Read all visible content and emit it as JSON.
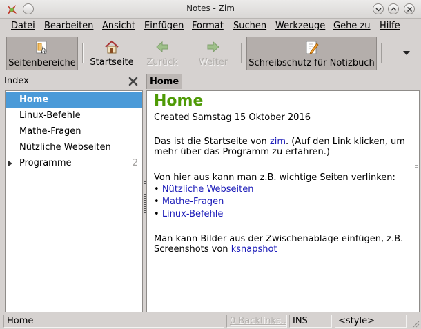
{
  "window": {
    "title": "Notes - Zim"
  },
  "menu": [
    "Datei",
    "Bearbeiten",
    "Ansicht",
    "Einfügen",
    "Format",
    "Suchen",
    "Werkzeuge",
    "Gehe zu",
    "Hilfe"
  ],
  "toolbar": {
    "side_panes": "Seitenbereiche",
    "home": "Startseite",
    "back": "Zurück",
    "forward": "Weiter",
    "readonly": "Schreibschutz für Notizbuch"
  },
  "index_pane": {
    "label": "Index",
    "items": [
      {
        "label": "Home",
        "selected": true
      },
      {
        "label": "Linux-Befehle"
      },
      {
        "label": "Mathe-Fragen"
      },
      {
        "label": "Nützliche Webseiten"
      },
      {
        "label": "Programme",
        "count": "2",
        "expandable": true
      }
    ]
  },
  "tab": {
    "label": "Home"
  },
  "page": {
    "title": "Home",
    "created": "Created Samstag 15 Oktober 2016",
    "intro_part1": "Das ist die Startseite von ",
    "intro_link": "zim",
    "intro_part2": ". (Auf den Link klicken, um",
    "intro_line2": "mehr über das Programm zu erfahren.)",
    "links_intro": "Von hier aus kann man z.B. wichtige Seiten verlinken:",
    "bullet_links": [
      "Nützliche Webseiten",
      "Mathe-Fragen",
      "Linux-Befehle"
    ],
    "screenshot_line1": "Man kann Bilder aus der Zwischenablage einfügen, z.B.",
    "screenshot_part1": "Screenshots von ",
    "screenshot_link": "ksnapshot"
  },
  "statusbar": {
    "page": "Home",
    "backlinks": "0 Backlinks...",
    "mode": "INS",
    "style": "<style>"
  },
  "colors": {
    "selection": "#4a9ad8",
    "title_green": "#4e9a06",
    "link_blue": "#1a1ab8"
  }
}
